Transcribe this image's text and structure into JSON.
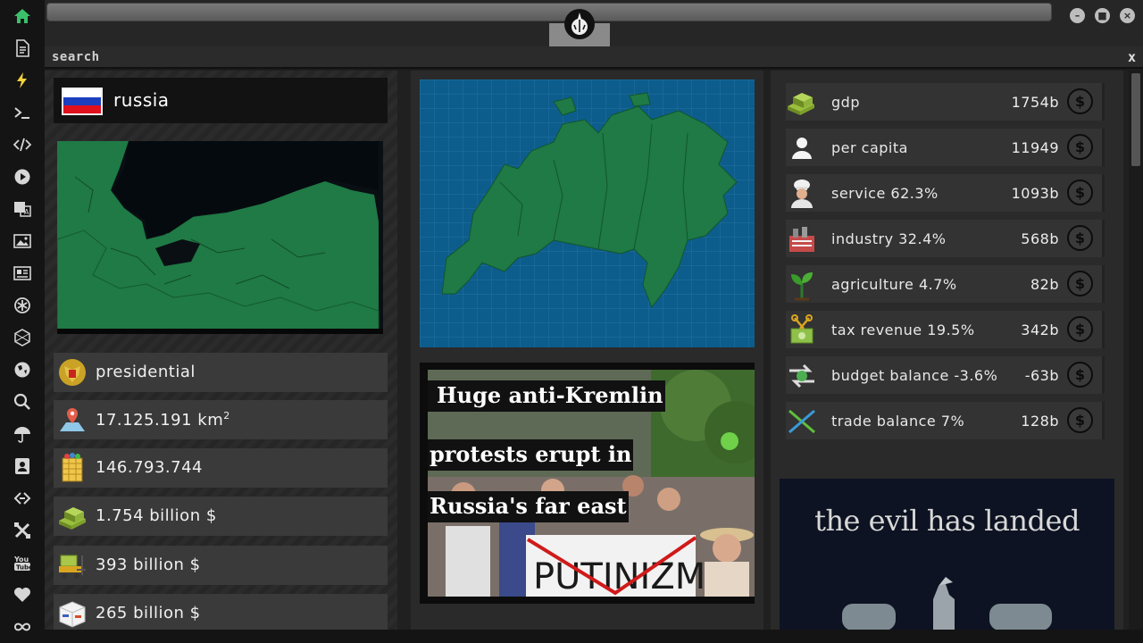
{
  "sidebar": {
    "icons": [
      "home-icon",
      "document-icon",
      "lightning-icon",
      "terminal-icon",
      "code-icon",
      "play-icon",
      "translate-icon",
      "image-icon",
      "newspaper-icon",
      "settings-icon",
      "hexagon-icon",
      "globe-icon",
      "search-icon",
      "umbrella-icon",
      "contact-icon",
      "link-icon",
      "tools-icon",
      "youtube-icon",
      "heart-icon",
      "infinity-icon"
    ]
  },
  "titlebar": {
    "logo": "rebel-alliance-icon"
  },
  "search": {
    "label": "search",
    "close": "x"
  },
  "country": {
    "name": "russia",
    "flag_colors": [
      "#ffffff",
      "#1c3fbf",
      "#e0101d"
    ]
  },
  "facts": [
    {
      "icon": "emblem-icon",
      "text": "presidential"
    },
    {
      "icon": "area-map-icon",
      "text": "17.125.191 km",
      "sup": "2"
    },
    {
      "icon": "population-icon",
      "text": "146.793.744"
    },
    {
      "icon": "money-stack-icon",
      "text": "1.754 billion $"
    },
    {
      "icon": "forklift-money-icon",
      "text": "393 billion $"
    },
    {
      "icon": "shipping-box-icon",
      "text": "265 billion $"
    }
  ],
  "news": {
    "headline_lines": [
      "Huge anti-Kremlin",
      "protests erupt in",
      "Russia's far east"
    ],
    "sign_text": "PUTINIZM"
  },
  "economy": [
    {
      "icon": "money-stack-icon",
      "label": "gdp",
      "value": "1754b"
    },
    {
      "icon": "person-icon",
      "label": "per capita",
      "value": "11949"
    },
    {
      "icon": "chef-icon",
      "label": "service 62.3%",
      "value": "1093b"
    },
    {
      "icon": "factory-icon",
      "label": "industry 32.4%",
      "value": "568b"
    },
    {
      "icon": "plant-icon",
      "label": "agriculture 4.7%",
      "value": "82b"
    },
    {
      "icon": "scissors-money-icon",
      "label": "tax revenue 19.5%",
      "value": "342b"
    },
    {
      "icon": "exchange-icon",
      "label": "budget balance -3.6%",
      "value": "-63b"
    },
    {
      "icon": "trade-icon",
      "label": "trade balance 7%",
      "value": "128b"
    }
  ],
  "coin_symbol": "$",
  "ad": {
    "text": "the evil has landed"
  }
}
